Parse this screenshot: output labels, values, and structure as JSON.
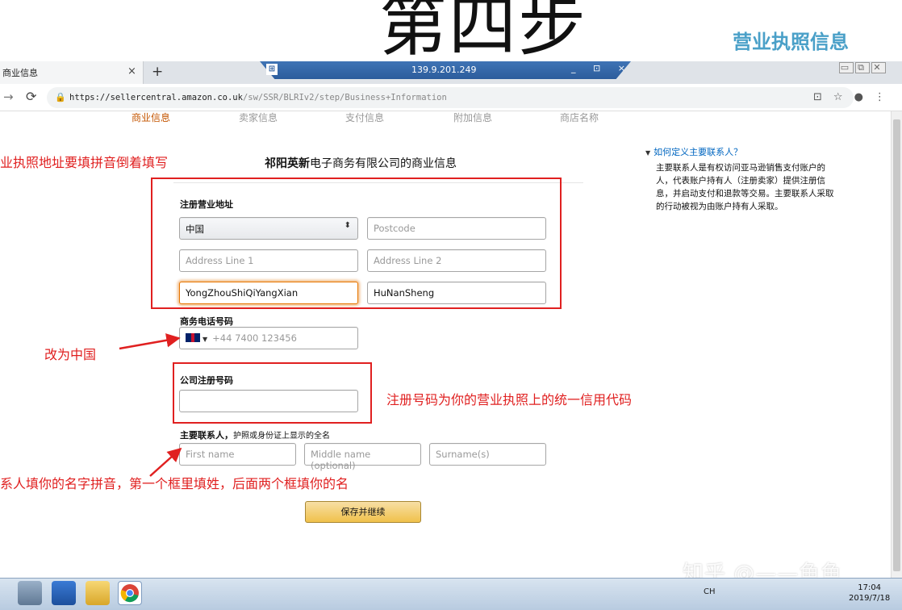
{
  "overlay": {
    "step_title": "第四步",
    "step_subtitle": "营业执照信息",
    "watermark": "知乎 @——鱼鱼"
  },
  "browser": {
    "tab_title": "商业信息",
    "tab_close": "×",
    "new_tab": "+",
    "url_main": "https://sellercentral.amazon.co.uk",
    "url_path": "/sw/SSR/BLRIv2/step/Business+Information",
    "rdp_ip": "139.9.201.249",
    "rdp_pin": "⊞",
    "rdp_controls": "_ ⊡ ×"
  },
  "steps": [
    "商业信息",
    "卖家信息",
    "支付信息",
    "附加信息",
    "商店名称"
  ],
  "form": {
    "title_bold": "祁阳英新",
    "title_rest": "电子商务有限公司的商业信息",
    "address_label": "注册营业地址",
    "country": "中国",
    "postcode_placeholder": "Postcode",
    "address1_placeholder": "Address Line 1",
    "address2_placeholder": "Address Line 2",
    "city_value": "YongZhouShiQiYangXian",
    "state_value": "HuNanSheng",
    "phone_label": "商务电话号码",
    "phone_placeholder": "+44 7400 123456",
    "regno_label": "公司注册号码",
    "contact_label_bold": "主要联系人，",
    "contact_label_rest": "护照或身份证上显示的全名",
    "first_name_placeholder": "First name",
    "middle_name_placeholder": "Middle name (optional)",
    "surname_placeholder": "Surname(s)",
    "save_button": "保存并继续"
  },
  "help": {
    "title": "如何定义主要联系人？",
    "body": "主要联系人是有权访问亚马逊销售支付账户的人，代表账户持有人（注册卖家）提供注册信息，并启动支付和退款等交易。主要联系人采取的行动被视为由账户持有人采取。"
  },
  "annotations": {
    "address_note": "业执照地址要填拼音倒着填写",
    "phone_note": "改为中国",
    "regno_note": "注册号码为你的营业执照上的统一信用代码",
    "name_note": "系人填你的名字拼音，第一个框里填姓，后面两个框填你的名"
  },
  "taskbar": {
    "tray_lang": "CH",
    "clock_time": "17:04",
    "clock_date": "2019/7/18"
  },
  "colors": {
    "annotation_red": "#e02020",
    "active_step": "#c45500",
    "link_blue": "#0066c0",
    "button_yellow": "#f0c14b",
    "subtitle_blue": "#4aa0c8"
  }
}
